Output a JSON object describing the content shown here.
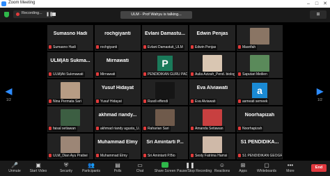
{
  "window": {
    "title": "Zoom Meeting"
  },
  "top": {
    "recording_label": "Recording...",
    "speaking_label": "ULM - Prof Wahyu is talking...",
    "view_label": "View"
  },
  "gallery": {
    "page_left": "1/2",
    "page_right": "1/2",
    "tiles": [
      {
        "big": "Sumasno Hadi",
        "label": "Sumasno Hadi"
      },
      {
        "big": "rochgiyanti",
        "label": "rochgiyanti"
      },
      {
        "big": "Evlani Damastu...",
        "label": "Evlani Damastuti_ULM"
      },
      {
        "big": "Edwin Penjas",
        "label": "Edwin Penjas"
      },
      {
        "big": "",
        "label": "Masrifah",
        "avatar_color": "#8a7564"
      },
      {
        "big": "ULM|Ati Sukma...",
        "label": "ULM|Ati Sukmawati"
      },
      {
        "big": "Mirnawati",
        "label": "Mirnawati"
      },
      {
        "big": "",
        "label": "PENDIDIKAN GURU PAD...",
        "letter": "P",
        "letter_bg": "#1a7a5a"
      },
      {
        "big": "",
        "label": "Aulia Azizah_Pend. biologi",
        "avatar_color": "#d9c6b2"
      },
      {
        "big": "",
        "label": "Saputari Meilien",
        "avatar_color": "#5a8a5a"
      },
      {
        "big": "",
        "label": "Nina Permata Sari",
        "avatar_color": "#b79c84"
      },
      {
        "big": "Yusuf Hidayat",
        "label": "Yusuf Hidayat"
      },
      {
        "big": "",
        "label": "Rusdi effendi",
        "avatar_color": "#151515"
      },
      {
        "big": "Eva Alviawati",
        "label": "Eva Alviawati"
      },
      {
        "big": "",
        "label": "asmeati semeek",
        "letter": "a",
        "letter_bg": "#1a8ad4"
      },
      {
        "big": "",
        "label": "faisal setiawan",
        "avatar_color": "#3c5e42"
      },
      {
        "big": "akhmad riandy...",
        "label": "akhmad riandy agusta_U..."
      },
      {
        "big": "",
        "label": "Raharian Sari",
        "avatar_color": "#6f5a4b"
      },
      {
        "big": "",
        "label": "Amanda Setiawan",
        "avatar_color": "#c84040"
      },
      {
        "big": "Noorhapizah",
        "label": "Noorhapizah"
      },
      {
        "big": "",
        "label": "ULM_Dian Ayu Pratiwi",
        "avatar_color": "#9c8676"
      },
      {
        "big": "Muhammad Elmy",
        "label": "Muhammad Elmy"
      },
      {
        "big": "Sri Amintarti P...",
        "label": "Sri Amintarti P.Bio"
      },
      {
        "big": "",
        "label": "Sesty Fatrima Hamsi",
        "avatar_color": "#cfb9a8"
      },
      {
        "big": "S1 PENDIDIKA...",
        "label": "S1 PENDIDIKAN GEOGRAFI"
      }
    ]
  },
  "toolbar": {
    "items": [
      {
        "label": "Unmute",
        "icon": "mic-muted-icon"
      },
      {
        "label": "Start Video",
        "icon": "video-off-icon"
      },
      {
        "label": "Security",
        "icon": "shield-icon"
      },
      {
        "label": "Participants",
        "icon": "participants-icon"
      },
      {
        "label": "Polls",
        "icon": "polls-icon"
      },
      {
        "label": "Chat",
        "icon": "chat-icon"
      },
      {
        "label": "Share Screen",
        "icon": "share-screen-icon"
      },
      {
        "label": "Pause/Stop Recording",
        "icon": "recording-icon"
      },
      {
        "label": "Reactions",
        "icon": "reactions-icon"
      },
      {
        "label": "Apps",
        "icon": "apps-icon"
      },
      {
        "label": "Whiteboards",
        "icon": "whiteboard-icon"
      },
      {
        "label": "More",
        "icon": "more-icon"
      }
    ],
    "end_label": "End"
  }
}
